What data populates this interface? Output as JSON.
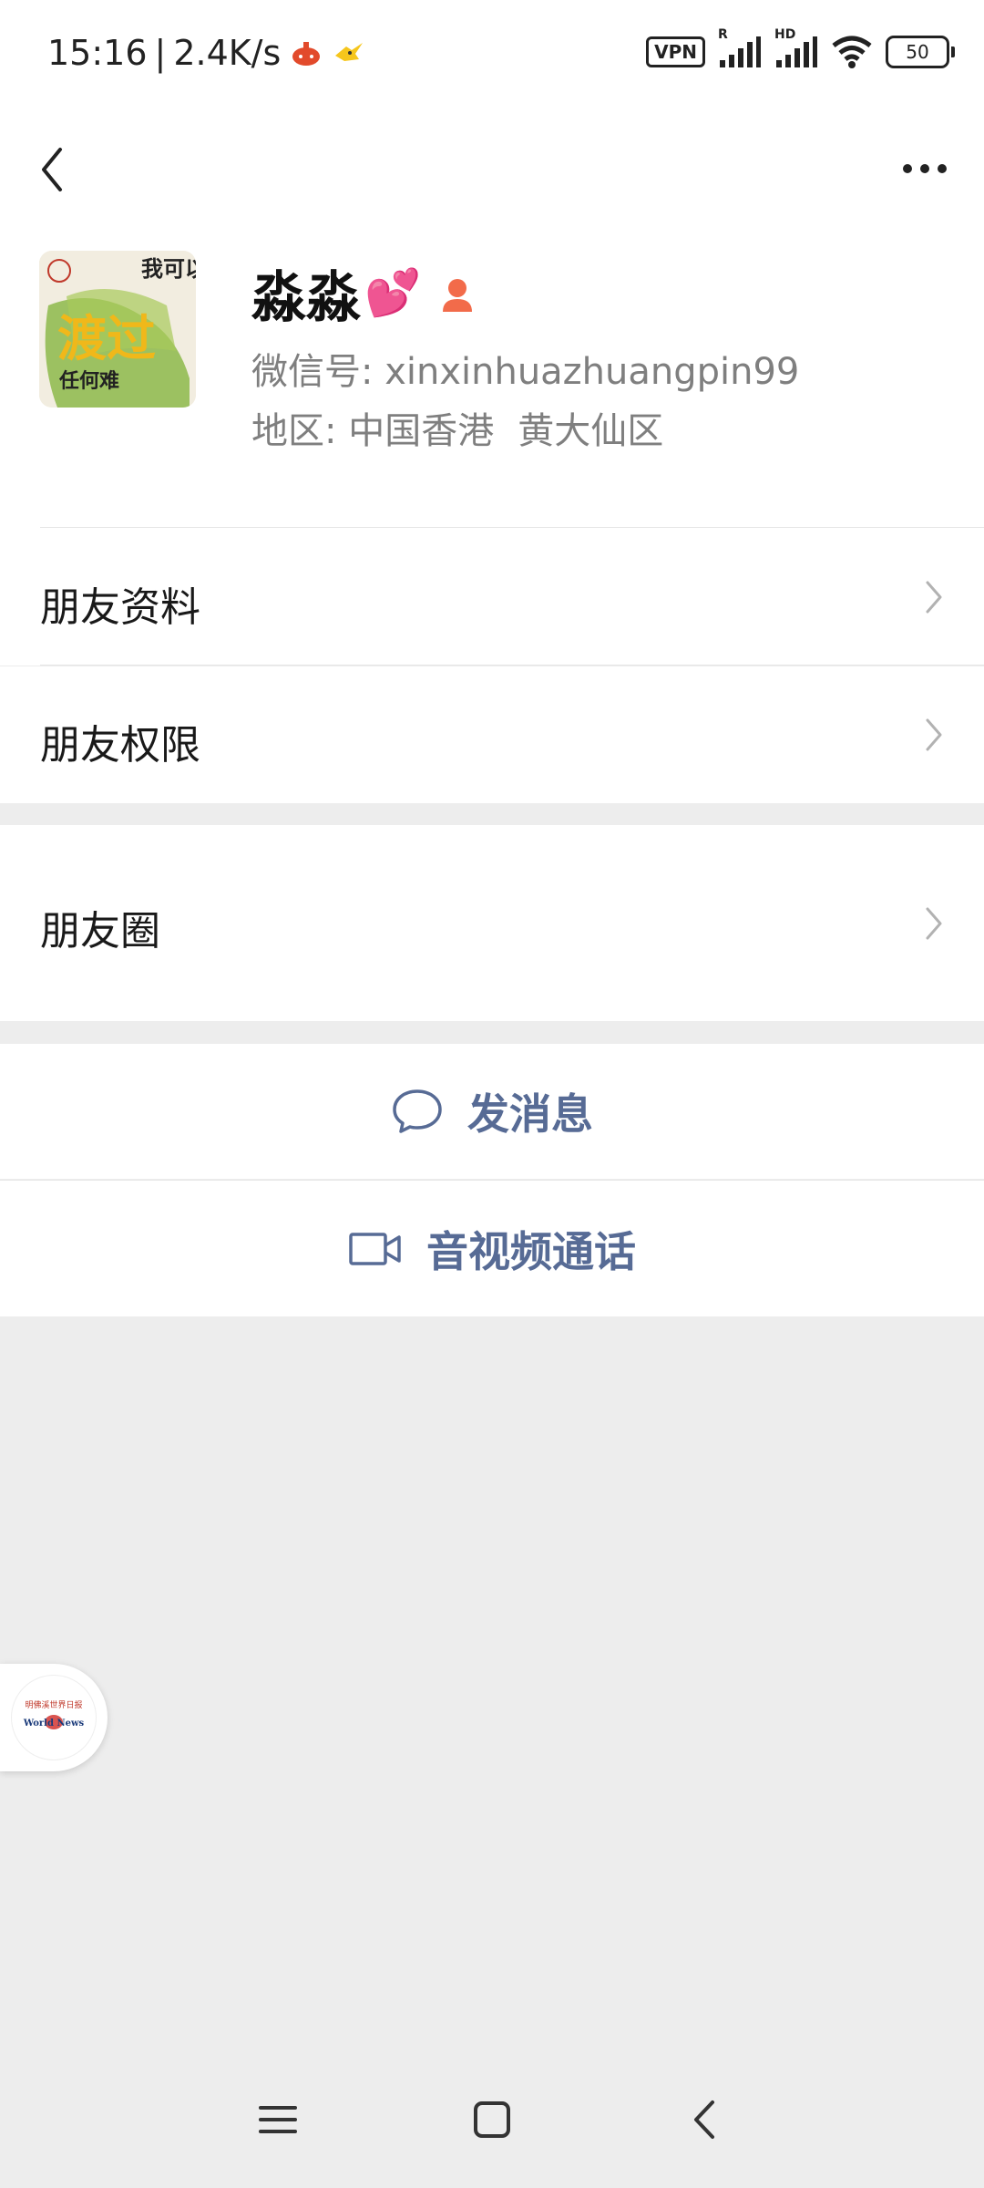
{
  "status_bar": {
    "time": "15:16",
    "net_speed": "2.4K/s",
    "vpn_label": "VPN",
    "signal1_tag": "R",
    "signal2_tag": "HD",
    "battery": "50"
  },
  "profile": {
    "name": "淼淼",
    "name_emoji": "💕",
    "wechat_id": "微信号: xinxinhuazhuangpin99",
    "region_label": "地区: 中国香港",
    "region_district": "黄大仙区",
    "avatar_text": [
      "我可以",
      "渡过",
      "任何难"
    ]
  },
  "menu": {
    "friend_info": "朋友资料",
    "friend_permissions": "朋友权限",
    "moments": "朋友圈"
  },
  "actions": {
    "send_message": "发消息",
    "av_call": "音视频通话"
  },
  "float_badge": {
    "top_text": "明佛溪世界日报",
    "bottom_text": "World News"
  },
  "colors": {
    "link_blue": "#576b95",
    "background": "#ededed",
    "gender_icon": "#f26b4a"
  }
}
